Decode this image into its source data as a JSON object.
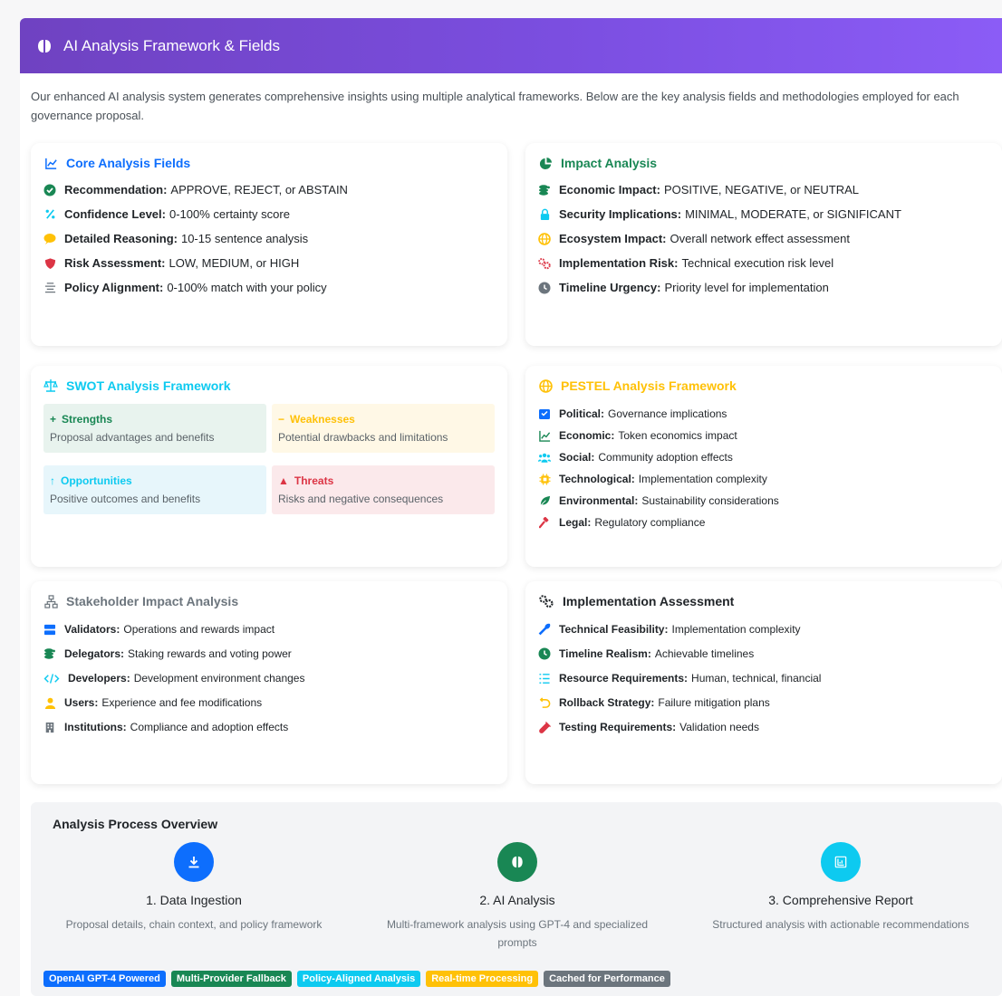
{
  "header": {
    "title": "AI Analysis Framework & Fields",
    "icon": "brain-icon"
  },
  "intro": "Our enhanced AI analysis system generates comprehensive insights using multiple analytical frameworks. Below are the key analysis fields and methodologies employed for each governance proposal.",
  "core": {
    "title": "Core Analysis Fields",
    "color": "#0d6efd",
    "items": [
      {
        "label": "Recommendation:",
        "text": "APPROVE, REJECT, or ABSTAIN",
        "icon": "check-circle-icon",
        "color": "#198754"
      },
      {
        "label": "Confidence Level:",
        "text": "0-100% certainty score",
        "icon": "percent-icon",
        "color": "#0dcaf0"
      },
      {
        "label": "Detailed Reasoning:",
        "text": "10-15 sentence analysis",
        "icon": "comment-icon",
        "color": "#ffc107"
      },
      {
        "label": "Risk Assessment:",
        "text": "LOW, MEDIUM, or HIGH",
        "icon": "shield-icon",
        "color": "#dc3545"
      },
      {
        "label": "Policy Alignment:",
        "text": "0-100% match with your policy",
        "icon": "align-icon",
        "color": "#6c757d"
      }
    ]
  },
  "impact": {
    "title": "Impact Analysis",
    "color": "#198754",
    "items": [
      {
        "label": "Economic Impact:",
        "text": "POSITIVE, NEGATIVE, or NEUTRAL",
        "icon": "coins-icon",
        "color": "#198754"
      },
      {
        "label": "Security Implications:",
        "text": "MINIMAL, MODERATE, or SIGNIFICANT",
        "icon": "lock-icon",
        "color": "#0dcaf0"
      },
      {
        "label": "Ecosystem Impact:",
        "text": "Overall network effect assessment",
        "icon": "globe-icon",
        "color": "#ffc107"
      },
      {
        "label": "Implementation Risk:",
        "text": "Technical execution risk level",
        "icon": "cogs-icon",
        "color": "#dc3545"
      },
      {
        "label": "Timeline Urgency:",
        "text": "Priority level for implementation",
        "icon": "clock-icon",
        "color": "#6c757d"
      }
    ]
  },
  "swot": {
    "title": "SWOT Analysis Framework",
    "color": "#0dcaf0",
    "boxes": [
      {
        "symbol": "+",
        "title": "Strengths",
        "desc": "Proposal advantages and benefits",
        "color": "#198754",
        "bg": "#e8f3ee"
      },
      {
        "symbol": "−",
        "title": "Weaknesses",
        "desc": "Potential drawbacks and limitations",
        "color": "#ffc107",
        "bg": "#fff8e6"
      },
      {
        "symbol": "↑",
        "title": "Opportunities",
        "desc": "Positive outcomes and benefits",
        "color": "#0dcaf0",
        "bg": "#e7f6fb"
      },
      {
        "symbol": "▲",
        "title": "Threats",
        "desc": "Risks and negative consequences",
        "color": "#dc3545",
        "bg": "#fbe9eb"
      }
    ]
  },
  "pestel": {
    "title": "PESTEL Analysis Framework",
    "color": "#ffc107",
    "items": [
      {
        "label": "Political:",
        "text": "Governance implications",
        "icon": "vote-icon",
        "color": "#0d6efd"
      },
      {
        "label": "Economic:",
        "text": "Token economics impact",
        "icon": "chart-line-icon",
        "color": "#198754"
      },
      {
        "label": "Social:",
        "text": "Community adoption effects",
        "icon": "users-icon",
        "color": "#0dcaf0"
      },
      {
        "label": "Technological:",
        "text": "Implementation complexity",
        "icon": "microchip-icon",
        "color": "#ffc107"
      },
      {
        "label": "Environmental:",
        "text": "Sustainability considerations",
        "icon": "leaf-icon",
        "color": "#198754"
      },
      {
        "label": "Legal:",
        "text": "Regulatory compliance",
        "icon": "gavel-icon",
        "color": "#dc3545"
      }
    ]
  },
  "stakeholder": {
    "title": "Stakeholder Impact Analysis",
    "color": "#6c757d",
    "items": [
      {
        "label": "Validators:",
        "text": "Operations and rewards impact",
        "icon": "server-icon",
        "color": "#0d6efd"
      },
      {
        "label": "Delegators:",
        "text": "Staking rewards and voting power",
        "icon": "coins-icon",
        "color": "#198754"
      },
      {
        "label": "Developers:",
        "text": "Development environment changes",
        "icon": "code-icon",
        "color": "#0dcaf0"
      },
      {
        "label": "Users:",
        "text": "Experience and fee modifications",
        "icon": "user-icon",
        "color": "#ffc107"
      },
      {
        "label": "Institutions:",
        "text": "Compliance and adoption effects",
        "icon": "building-icon",
        "color": "#6c757d"
      }
    ]
  },
  "implementation": {
    "title": "Implementation Assessment",
    "color": "#212529",
    "items": [
      {
        "label": "Technical Feasibility:",
        "text": "Implementation complexity",
        "icon": "wrench-icon",
        "color": "#0d6efd"
      },
      {
        "label": "Timeline Realism:",
        "text": "Achievable timelines",
        "icon": "clock-icon",
        "color": "#198754"
      },
      {
        "label": "Resource Requirements:",
        "text": "Human, technical, financial",
        "icon": "list-icon",
        "color": "#0dcaf0"
      },
      {
        "label": "Rollback Strategy:",
        "text": "Failure mitigation plans",
        "icon": "undo-icon",
        "color": "#ffc107"
      },
      {
        "label": "Testing Requirements:",
        "text": "Validation needs",
        "icon": "vial-icon",
        "color": "#dc3545"
      }
    ]
  },
  "process": {
    "title": "Analysis Process Overview",
    "steps": [
      {
        "name": "1. Data Ingestion",
        "desc": "Proposal details, chain context, and policy framework",
        "icon": "download-icon",
        "color": "#0d6efd"
      },
      {
        "name": "2. AI Analysis",
        "desc": "Multi-framework analysis using GPT-4 and specialized prompts",
        "icon": "brain-icon",
        "color": "#198754"
      },
      {
        "name": "3. Comprehensive Report",
        "desc": "Structured analysis with actionable recommendations",
        "icon": "report-icon",
        "color": "#0dcaf0"
      }
    ]
  },
  "badges": [
    {
      "label": "OpenAI GPT-4 Powered",
      "color": "#0d6efd"
    },
    {
      "label": "Multi-Provider Fallback",
      "color": "#198754"
    },
    {
      "label": "Policy-Aligned Analysis",
      "color": "#0dcaf0"
    },
    {
      "label": "Real-time Processing",
      "color": "#ffc107"
    },
    {
      "label": "Cached for Performance",
      "color": "#6c757d"
    }
  ]
}
